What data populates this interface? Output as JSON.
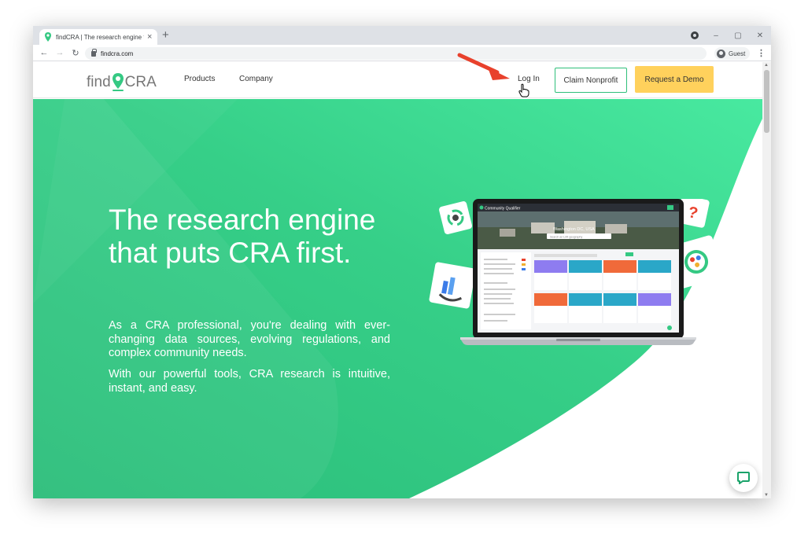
{
  "browser": {
    "tab_title": "findCRA | The research engine th",
    "tab_close": "×",
    "new_tab": "+",
    "url": "findcra.com",
    "profile_label": "Guest",
    "window_controls": [
      "–",
      "▢",
      "✕"
    ]
  },
  "site": {
    "logo_left": "find",
    "logo_right": "CRA",
    "nav": [
      "Products",
      "Company"
    ],
    "login": "Log In",
    "claim_button": "Claim Nonprofit",
    "demo_button": "Request a Demo"
  },
  "hero": {
    "title": "The research engine that puts CRA first.",
    "paragraph1": "As a CRA professional, you're dealing with ever-changing data sources, evolving regulations, and complex community needs.",
    "paragraph2": "With our powerful tools, CRA research is intuitive, instant, and easy."
  },
  "screen": {
    "app_name": "Community Qualifier",
    "location": "Washington DC, USA",
    "search_placeholder": "Search an LMI geography"
  },
  "colors": {
    "hero_green": "#35c983",
    "hero_light": "#4ae79e",
    "claim_border": "#2fbf7a",
    "demo_yellow": "#ffd15c",
    "annotation_red": "#e8412c"
  },
  "icons": [
    "map-pin-icon",
    "lock-icon",
    "guest-avatar-icon",
    "chat-icon",
    "arrow-annotation",
    "hand-cursor-icon"
  ]
}
